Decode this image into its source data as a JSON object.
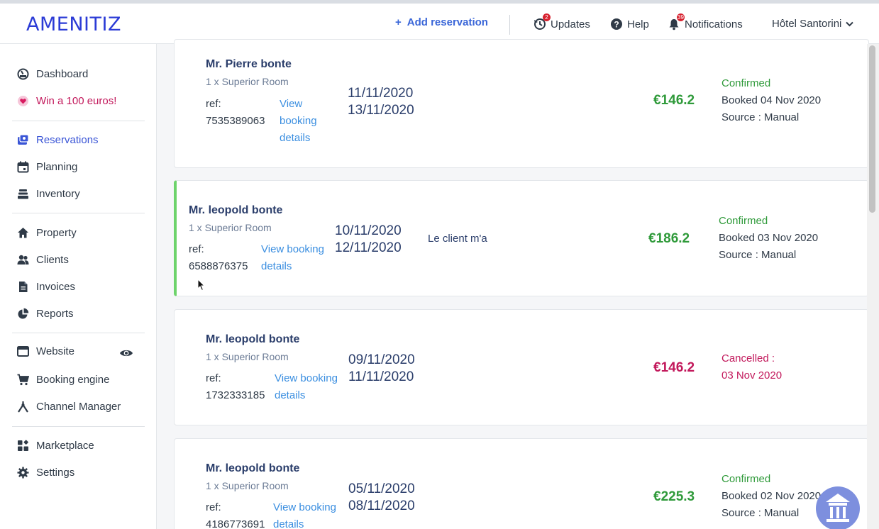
{
  "header": {
    "logo": "AMENITIZ",
    "add_reservation": "Add reservation",
    "updates": "Updates",
    "updates_badge": "2",
    "help": "Help",
    "notifications": "Notifications",
    "notifications_badge": "39",
    "hotel": "Hôtel Santorini"
  },
  "sidebar": {
    "items": [
      {
        "label": "Dashboard",
        "icon": "gauge-icon"
      },
      {
        "label": "Win a 100 euros!",
        "icon": "heart-icon"
      },
      {
        "label": "Reservations",
        "icon": "reservations-icon"
      },
      {
        "label": "Planning",
        "icon": "calendar-icon"
      },
      {
        "label": "Inventory",
        "icon": "inventory-icon"
      },
      {
        "label": "Property",
        "icon": "home-icon"
      },
      {
        "label": "Clients",
        "icon": "users-icon"
      },
      {
        "label": "Invoices",
        "icon": "file-icon"
      },
      {
        "label": "Reports",
        "icon": "pie-chart-icon"
      },
      {
        "label": "Website",
        "icon": "browser-icon"
      },
      {
        "label": "Booking engine",
        "icon": "cart-icon"
      },
      {
        "label": "Channel Manager",
        "icon": "channel-icon"
      },
      {
        "label": "Marketplace",
        "icon": "apps-icon"
      },
      {
        "label": "Settings",
        "icon": "gear-icon"
      }
    ]
  },
  "reservations": [
    {
      "name": "Mr. Pierre bonte",
      "room": "1 x Superior Room",
      "ref_label": "ref:",
      "ref": "7535389063",
      "link1": "View",
      "link2": "booking",
      "link3": "details",
      "date_from": "11/11/2020",
      "date_to": "13/11/2020",
      "note": "",
      "price": "€146.2",
      "status": "Confirmed",
      "booked": "Booked 04 Nov 2020",
      "source": "Source : Manual"
    },
    {
      "name": "Mr. leopold bonte",
      "room": "1 x Superior Room",
      "ref_label": "ref:",
      "ref": "6588876375",
      "link1": "View booking",
      "link2": "details",
      "date_from": "10/11/2020",
      "date_to": "12/11/2020",
      "note": "Le client m'a",
      "price": "€186.2",
      "status": "Confirmed",
      "booked": "Booked 03 Nov 2020",
      "source": "Source : Manual"
    },
    {
      "name": "Mr. leopold bonte",
      "room": "1 x Superior Room",
      "ref_label": "ref:",
      "ref": "1732333185",
      "link1": "View booking",
      "link2": "details",
      "date_from": "09/11/2020",
      "date_to": "11/11/2020",
      "note": "",
      "price": "€146.2",
      "status": "Cancelled :",
      "booked": "03 Nov 2020",
      "source": ""
    },
    {
      "name": "Mr. leopold bonte",
      "room": "1 x Superior Room",
      "ref_label": "ref:",
      "ref": "4186773691",
      "link1": "View booking",
      "link2": "details",
      "date_from": "05/11/2020",
      "date_to": "08/11/2020",
      "note": "",
      "price": "€225.3",
      "status": "Confirmed",
      "booked": "Booked 02 Nov 2020",
      "source": "Source : Manual"
    }
  ],
  "colors": {
    "brand": "#2b3bd6",
    "confirmed": "#2f9a3a",
    "cancelled": "#c2185b",
    "link": "#3a8ee0",
    "highlight_border": "#6dd36b"
  }
}
